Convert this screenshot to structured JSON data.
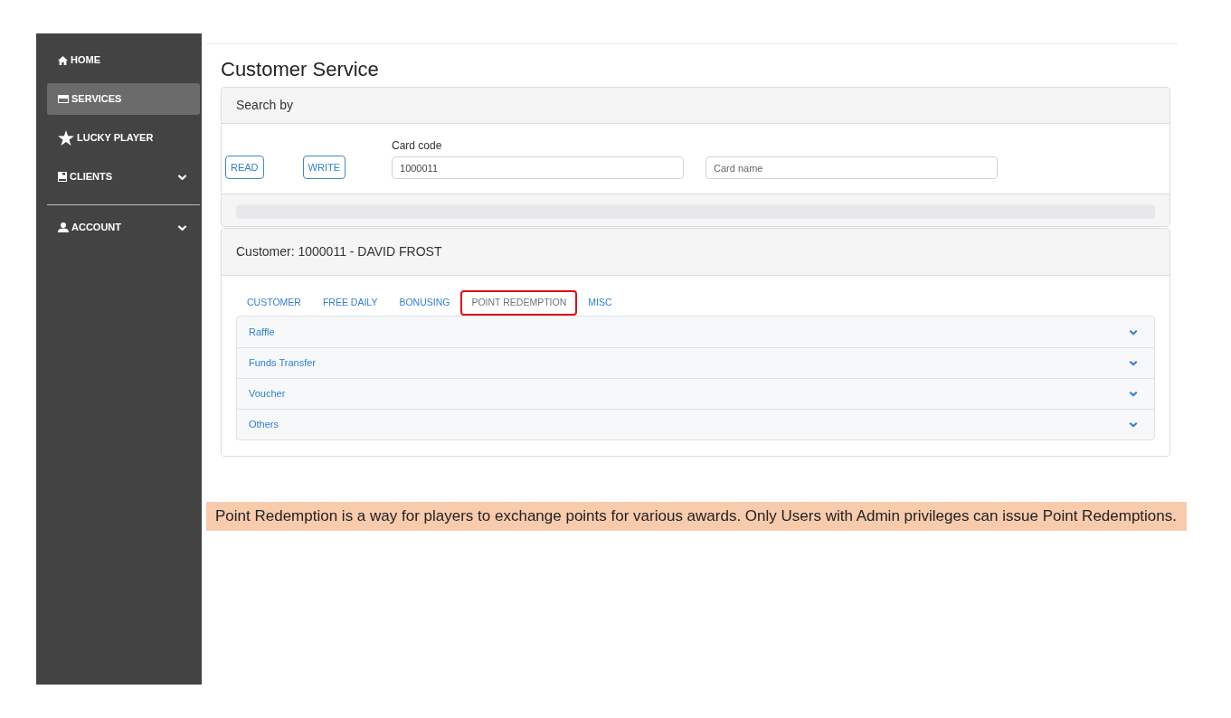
{
  "sidebar": {
    "sections": [
      {
        "items": [
          {
            "label": "HOME",
            "kind": "link",
            "selected": false
          },
          {
            "label": "SERVICES",
            "kind": "link",
            "selected": true
          },
          {
            "label": "LUCKY PLAYER",
            "kind": "link",
            "selected": false
          },
          {
            "label": "CLIENTS",
            "kind": "group",
            "selected": false
          }
        ]
      },
      {
        "items": [
          {
            "label": "ACCOUNT",
            "kind": "group",
            "selected": false
          }
        ]
      }
    ]
  },
  "page": {
    "title": "Customer Service"
  },
  "search_panel": {
    "header": "Search by",
    "buttons": [
      "READ",
      "WRITE"
    ],
    "card_code": {
      "label": "Card code",
      "value": "1000011"
    },
    "card_name": {
      "placeholder": "Card name"
    },
    "progress": {
      "level": 0
    }
  },
  "customer_panel": {
    "header": "Customer: 1000011 - DAVID FROST",
    "tabs": [
      {
        "label": "CUSTOMER",
        "selected": false,
        "highlighted": false
      },
      {
        "label": "FREE DAILY",
        "selected": false,
        "highlighted": false
      },
      {
        "label": "BONUSING",
        "selected": false,
        "highlighted": false
      },
      {
        "label": "POINT REDEMPTION",
        "selected": true,
        "highlighted": true
      },
      {
        "label": "MISC",
        "selected": false,
        "highlighted": false
      }
    ],
    "sections": [
      {
        "title": "Raffle",
        "expanded": false
      },
      {
        "title": "Funds Transfer",
        "expanded": false
      },
      {
        "title": "Voucher",
        "expanded": false
      },
      {
        "title": "Others",
        "expanded": false
      }
    ]
  },
  "caption": "Point Redemption is a way for players to exchange points for various awards. Only Users with Admin privileges can issue Point Redemptions."
}
